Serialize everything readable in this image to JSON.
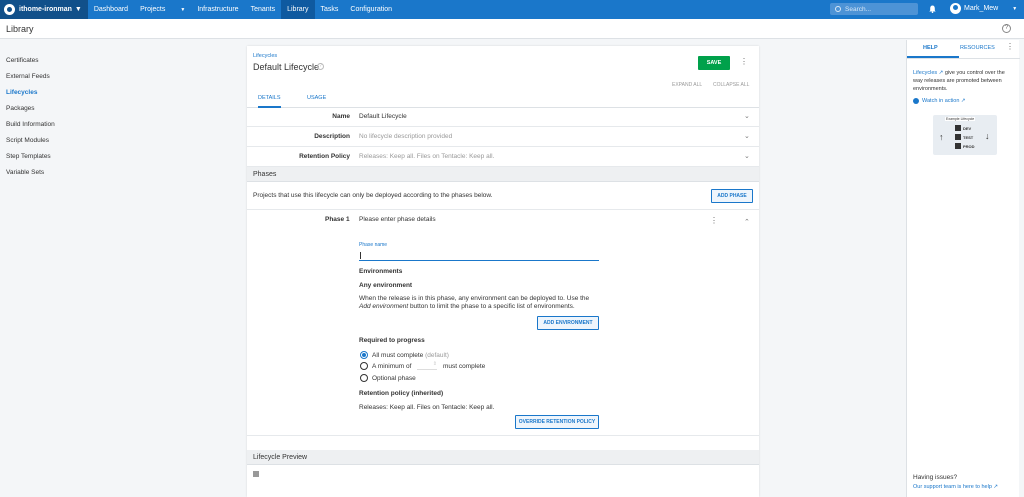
{
  "nav": {
    "space": "ithome-ironman",
    "items": [
      "Dashboard",
      "Projects",
      "Infrastructure",
      "Tenants",
      "Library",
      "Tasks",
      "Configuration"
    ],
    "search_placeholder": "Search...",
    "user": "Mark_Mew"
  },
  "subheader": {
    "title": "Library"
  },
  "sidebar": {
    "items": [
      "Certificates",
      "External Feeds",
      "Lifecycles",
      "Packages",
      "Build Information",
      "Script Modules",
      "Step Templates",
      "Variable Sets"
    ],
    "active": "Lifecycles"
  },
  "main": {
    "breadcrumb": "Lifecycles",
    "title": "Default Lifecycle",
    "save_label": "SAVE",
    "expand_all": "EXPAND ALL",
    "collapse_all": "COLLAPSE ALL",
    "tabs": [
      "DETAILS",
      "USAGE"
    ],
    "fields": [
      {
        "label": "Name",
        "value": "Default Lifecycle"
      },
      {
        "label": "Description",
        "value": "No lifecycle description provided"
      },
      {
        "label": "Retention Policy",
        "value": "Releases: Keep all. Files on Tentacle: Keep all."
      }
    ],
    "phases_heading": "Phases",
    "phases_note": "Projects that use this lifecycle can only be deployed according to the phases below.",
    "add_phase_label": "ADD PHASE",
    "phase": {
      "label": "Phase 1",
      "summary": "Please enter phase details",
      "name_field_label": "Phase name",
      "name_value": "",
      "environments_heading": "Environments",
      "any_env_heading": "Any environment",
      "any_env_text_1": "When the release is in this phase, any environment can be deployed to. Use the",
      "any_env_text_2a": "Add environment",
      "any_env_text_2b": " button to limit the phase to a specific list of environments.",
      "add_env_label": "ADD ENVIRONMENT",
      "required_heading": "Required to progress",
      "option_all": "All must complete",
      "option_all_hint": "(default)",
      "option_min_prefix": "A minimum of",
      "option_min_suffix": "must complete",
      "option_optional": "Optional phase",
      "retention_heading": "Retention policy (inherited)",
      "retention_text": "Releases: Keep all. Files on Tentacle: Keep all.",
      "override_label": "OVERRIDE RETENTION POLICY"
    },
    "preview_heading": "Lifecycle Preview"
  },
  "help": {
    "tabs": [
      "HELP",
      "RESOURCES"
    ],
    "link_word": "Lifecycles",
    "desc_rest": " give you control over the way releases are promoted between environments.",
    "watch_label": "Watch in action",
    "diagram_title": "Example Lifecycle",
    "diagram_envs": [
      "DEV",
      "TEST",
      "PROD"
    ],
    "issues_heading": "Having issues?",
    "support_text": "Our support team is here to help"
  },
  "colors": {
    "brand": "#1a77ca",
    "save": "#00a14b"
  }
}
